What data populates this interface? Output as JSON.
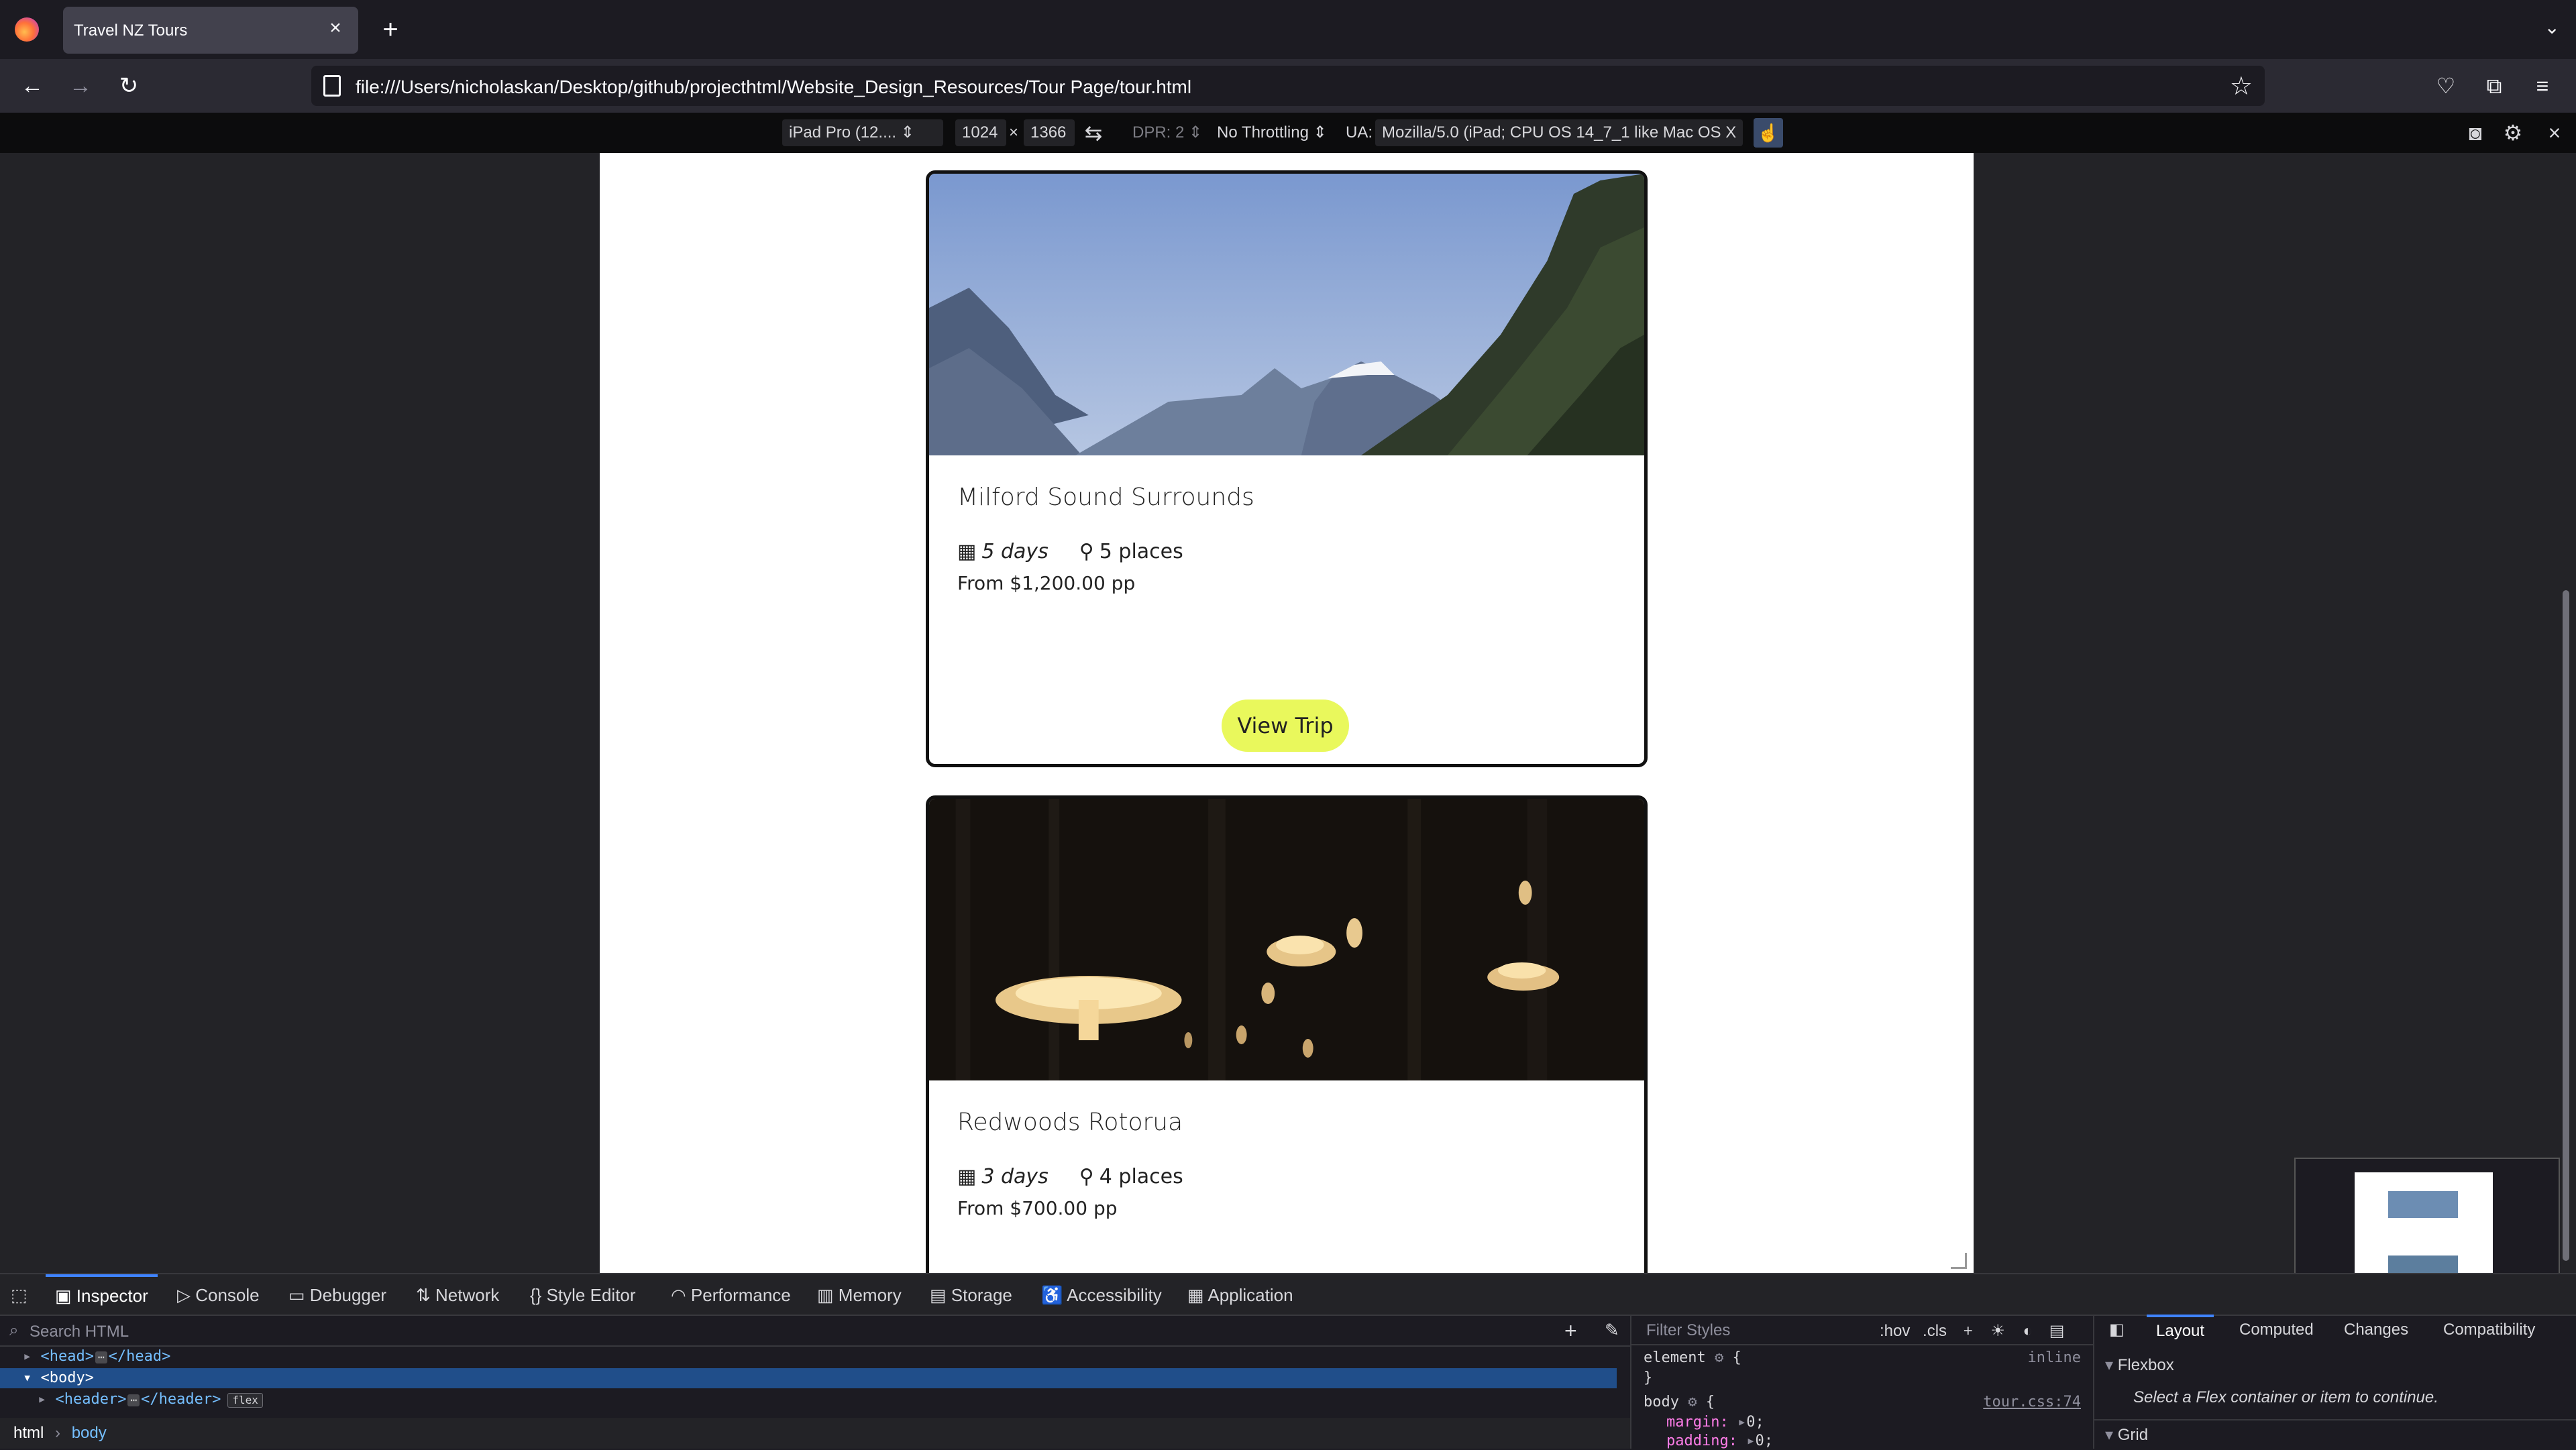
{
  "browser": {
    "tab_title": "Travel NZ Tours",
    "url": "file:///Users/nicholaskan/Desktop/github/projecthtml/Website_Design_Resources/Tour Page/tour.html"
  },
  "responsive_toolbar": {
    "device": "iPad Pro (12....",
    "width": "1024",
    "times": "×",
    "height": "1366",
    "dpr": "DPR: 2",
    "throttling": "No Throttling",
    "ua_label": "UA:",
    "ua_value": "Mozilla/5.0 (iPad; CPU OS 14_7_1 like Mac OS X"
  },
  "tours": [
    {
      "title": "Milford Sound Surrounds",
      "duration": "5 days",
      "places": "5 places",
      "price": "From $1,200.00 pp",
      "button": "View Trip"
    },
    {
      "title": "Redwoods Rotorua",
      "duration": "3 days",
      "places": "4 places",
      "price": "From $700.00 pp"
    }
  ],
  "devtools": {
    "tabs": [
      "Inspector",
      "Console",
      "Debugger",
      "Network",
      "Style Editor",
      "Performance",
      "Memory",
      "Storage",
      "Accessibility",
      "Application"
    ],
    "search_placeholder": "Search HTML",
    "tree": {
      "head": "<head>",
      "head_close": "</head>",
      "body": "<body>",
      "header": "<header>",
      "header_close": "</header>",
      "flex_badge": "flex"
    },
    "breadcrumbs": [
      "html",
      "body"
    ],
    "rules": {
      "filter_placeholder": "Filter Styles",
      "hov": ":hov",
      "cls": ".cls",
      "element_selector": "element",
      "element_brace": "{",
      "element_close": "}",
      "element_source": "inline",
      "body_selector": "body",
      "body_brace": "{",
      "body_source": "tour.css:74",
      "margin_prop": "margin:",
      "margin_val": "0;",
      "padding_prop": "padding:",
      "padding_val": "0;"
    },
    "layout_tabs": [
      "Layout",
      "Computed",
      "Changes",
      "Compatibility"
    ],
    "flexbox_label": "Flexbox",
    "flexbox_note": "Select a Flex container or item to continue.",
    "grid_label": "Grid"
  }
}
